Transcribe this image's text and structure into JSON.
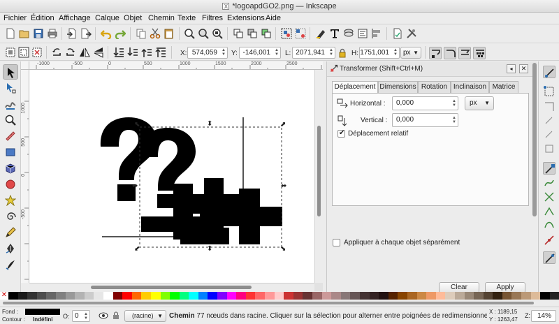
{
  "window": {
    "title": "*logoapdGO2.png — Inkscape"
  },
  "menu": [
    "Fichier",
    "Édition",
    "Affichage",
    "Calque",
    "Objet",
    "Chemin",
    "Texte",
    "Filtres",
    "Extensions",
    "Aide"
  ],
  "commands_toolbar": {
    "icons": [
      "new-document-icon",
      "open-icon",
      "save-icon",
      "print-icon",
      "import-icon",
      "export-icon",
      "undo-icon",
      "redo-icon",
      "copy-icon",
      "cut-icon",
      "paste-icon",
      "zoom-selection-icon",
      "zoom-drawing-icon",
      "zoom-page-icon",
      "duplicate-icon",
      "clone-icon",
      "unlink-clone-icon",
      "group-icon",
      "ungroup-icon",
      "fill-stroke-icon",
      "text-font-icon",
      "layers-icon",
      "xml-editor-icon",
      "align-distribute-icon",
      "document-properties-icon",
      "preferences-icon"
    ]
  },
  "select_toolbar": {
    "x": {
      "label": "X:",
      "value": "574,059"
    },
    "y": {
      "label": "Y:",
      "value": "-146,001"
    },
    "w": {
      "label": "L:",
      "value": "2071,941"
    },
    "h": {
      "label": "H:",
      "value": "1751,001"
    },
    "unit": "px"
  },
  "ruler": {
    "top": [
      "-1000",
      "-500",
      "0",
      "500",
      "1000",
      "1500",
      "2000",
      "2500"
    ],
    "left": [
      "1000",
      "500",
      "0",
      "-500"
    ]
  },
  "tools": [
    "selector-tool-icon",
    "node-tool-icon",
    "tweak-tool-icon",
    "zoom-tool-icon",
    "measure-tool-icon",
    "rectangle-tool-icon",
    "3d-box-tool-icon",
    "ellipse-tool-icon",
    "star-tool-icon",
    "spiral-tool-icon",
    "pencil-tool-icon",
    "pen-tool-icon",
    "calligraphy-tool-icon"
  ],
  "transform_dialog": {
    "title": "Transformer (Shift+Ctrl+M)",
    "tabs": [
      "Déplacement",
      "Dimensions",
      "Rotation",
      "Inclinaison",
      "Matrice"
    ],
    "active_tab": "Déplacement",
    "horizontal": {
      "label": "Horizontal :",
      "value": "0,000"
    },
    "vertical": {
      "label": "Vertical :",
      "value": "0,000"
    },
    "unit": "px",
    "relative_move": {
      "label": "Déplacement relatif",
      "checked": true
    },
    "apply_each": {
      "label": "Appliquer à chaque objet séparément",
      "checked": false
    },
    "clear_button": "Clear",
    "apply_button": "Apply"
  },
  "status": {
    "fill_label": "Fond :",
    "stroke_label": "Contour :",
    "stroke_value": "Indéfini",
    "opacity_label": "O:",
    "opacity_value": "0",
    "layer": "(racine)",
    "message_bold": "Chemin",
    "message": " 77 nœuds dans racine. Cliquer sur la sélection pour alterner entre poignées de redimensionnem",
    "x_coord": "X : 1189,15",
    "y_coord": "Y : 1263,47",
    "zoom_label": "Z:",
    "zoom": "14%"
  },
  "colors": {
    "accent": "#2a6db0",
    "palette": [
      "#000000",
      "#1a1a1a",
      "#333333",
      "#4d4d4d",
      "#666666",
      "#808080",
      "#999999",
      "#b3b3b3",
      "#cccccc",
      "#e6e6e6",
      "#ffffff",
      "#800000",
      "#ff0000",
      "#ff6600",
      "#ffcc00",
      "#ffff00",
      "#80ff00",
      "#00ff00",
      "#00ff80",
      "#00ffff",
      "#0080ff",
      "#0000ff",
      "#8000ff",
      "#ff00ff",
      "#ff0080",
      "#ff3333",
      "#ff6666",
      "#ff9999",
      "#ffcccc",
      "#cc3333",
      "#993333",
      "#663333",
      "#996666",
      "#cc9999",
      "#aa8888",
      "#887777",
      "#665555",
      "#443333",
      "#332222",
      "#221111",
      "#552200",
      "#884400",
      "#aa6622",
      "#cc8844",
      "#ee9966",
      "#ffbb99",
      "#ddccbb",
      "#bbaa99",
      "#998877",
      "#776655",
      "#554433",
      "#332211",
      "#775533",
      "#997755",
      "#bb9977",
      "#ddbb99",
      "#000000",
      "#222222"
    ]
  }
}
